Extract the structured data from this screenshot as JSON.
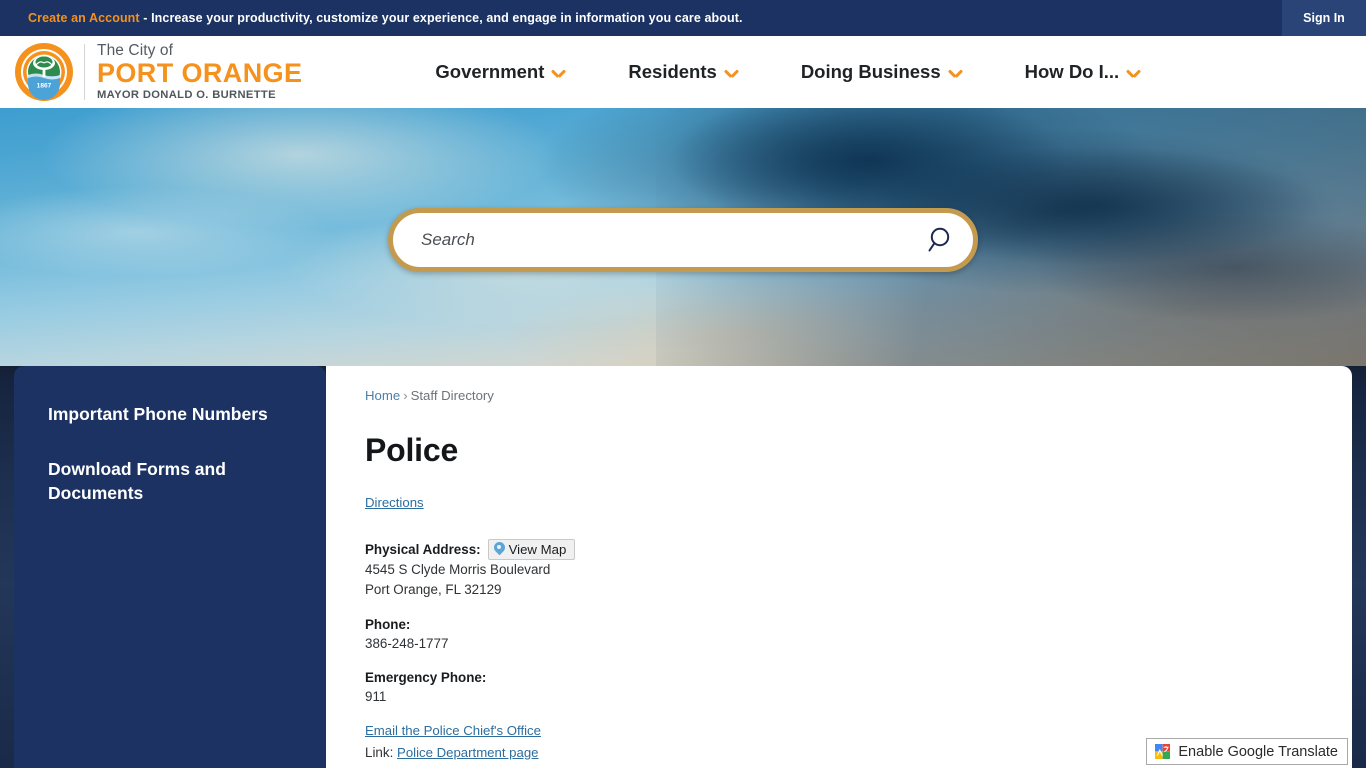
{
  "topbar": {
    "create_account": "Create an Account",
    "message": " - Increase your productivity, customize your experience, and engage in information you care about.",
    "signin": "Sign In"
  },
  "brand": {
    "city_line": "The City of",
    "name": "PORT ORANGE",
    "mayor": "MAYOR DONALD O. BURNETTE",
    "seal_year": "1867",
    "accent_color": "#f5921e",
    "navy_color": "#1b3263"
  },
  "nav": {
    "items": [
      {
        "label": "Government"
      },
      {
        "label": "Residents"
      },
      {
        "label": "Doing Business"
      },
      {
        "label": "How Do I..."
      }
    ]
  },
  "search": {
    "placeholder": "Search",
    "value": "",
    "icon": "search-icon",
    "border_color": "#c39a4e"
  },
  "sidebar": {
    "items": [
      {
        "label": "Important Phone Numbers"
      },
      {
        "label": "Download Forms and Documents"
      }
    ]
  },
  "main": {
    "breadcrumb": {
      "home": "Home",
      "separator": "›",
      "current": "Staff Directory"
    },
    "title": "Police",
    "directions_link": "Directions",
    "physical_address": {
      "label": "Physical Address:",
      "view_map_button": "View Map",
      "line1": "4545 S Clyde Morris Boulevard",
      "line2": "Port Orange, FL 32129"
    },
    "phone": {
      "label": "Phone:",
      "value": "386-248-1777"
    },
    "emergency_phone": {
      "label": "Emergency Phone:",
      "value": "911"
    },
    "email_link": "Email the Police Chief's Office",
    "link_prefix": "Link:",
    "link_label": "Police Department page"
  },
  "translate": {
    "label": "Enable Google Translate",
    "icon": "google-translate-icon"
  }
}
